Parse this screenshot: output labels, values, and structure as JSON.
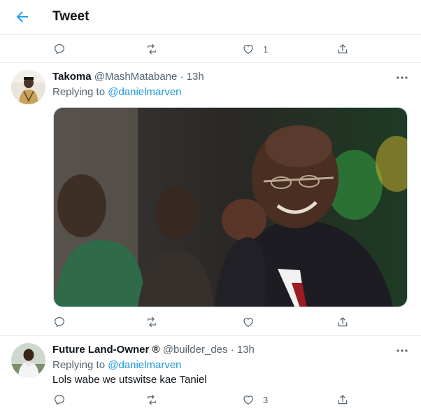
{
  "header": {
    "title": "Tweet"
  },
  "top_actions": {
    "like_count": "1"
  },
  "tweets": [
    {
      "author": "Takoma",
      "handle": "@MashMatabane",
      "separator": "·",
      "time": "13h",
      "replying_prefix": "Replying to",
      "replying_to": "@danielmarven",
      "text": "",
      "has_photo": true,
      "like_count": ""
    },
    {
      "author": "Future Land-Owner ®",
      "handle": "@builder_des",
      "separator": "·",
      "time": "13h",
      "replying_prefix": "Replying to",
      "replying_to": "@danielmarven",
      "text": "Lols wabe we utswitse kae Taniel",
      "has_photo": false,
      "like_count": "3"
    }
  ],
  "colors": {
    "accent": "#1da1f2",
    "icon_gray": "#536471",
    "divider": "#ebeef0"
  }
}
